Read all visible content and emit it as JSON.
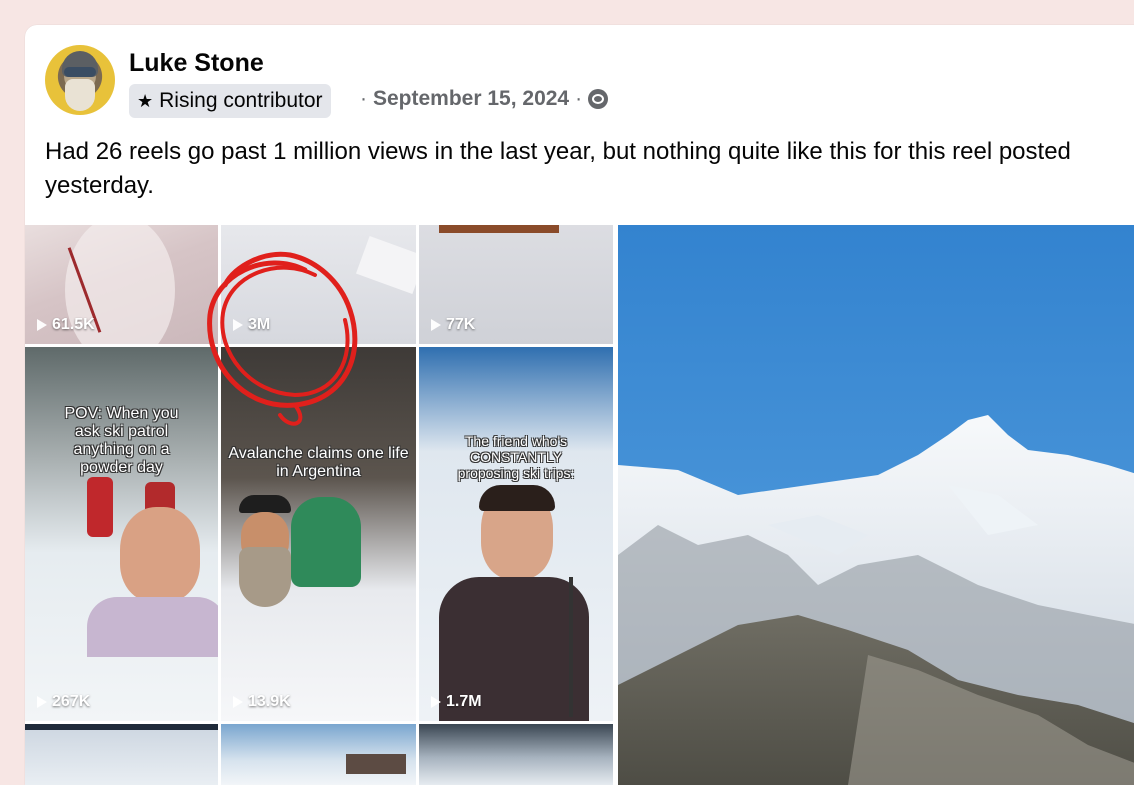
{
  "post": {
    "author": "Luke Stone",
    "badge": "Rising contributor",
    "separator1": "·",
    "date": "September 15, 2024",
    "separator2": "·",
    "text": "Had 26 reels go past 1 million views in the last year, but nothing quite like this for this reel posted yesterday."
  },
  "reels": [
    {
      "views": "61.5K",
      "caption": ""
    },
    {
      "views": "3M",
      "caption": ""
    },
    {
      "views": "77K",
      "caption": ""
    },
    {
      "views": "267K",
      "caption": "POV: When you ask ski patrol anything on a powder day"
    },
    {
      "views": "13.9K",
      "caption": "Avalanche claims one life in Argentina"
    },
    {
      "views": "1.7M",
      "caption": "The friend who's CONSTANTLY proposing ski trips:"
    }
  ],
  "icons": {
    "badge": "star-icon",
    "audience": "friends-icon",
    "play": "play-icon"
  },
  "colors": {
    "page_bg": "#f7e6e4",
    "circle_annotation": "#e0201c",
    "sky": "#3e8fd6"
  }
}
